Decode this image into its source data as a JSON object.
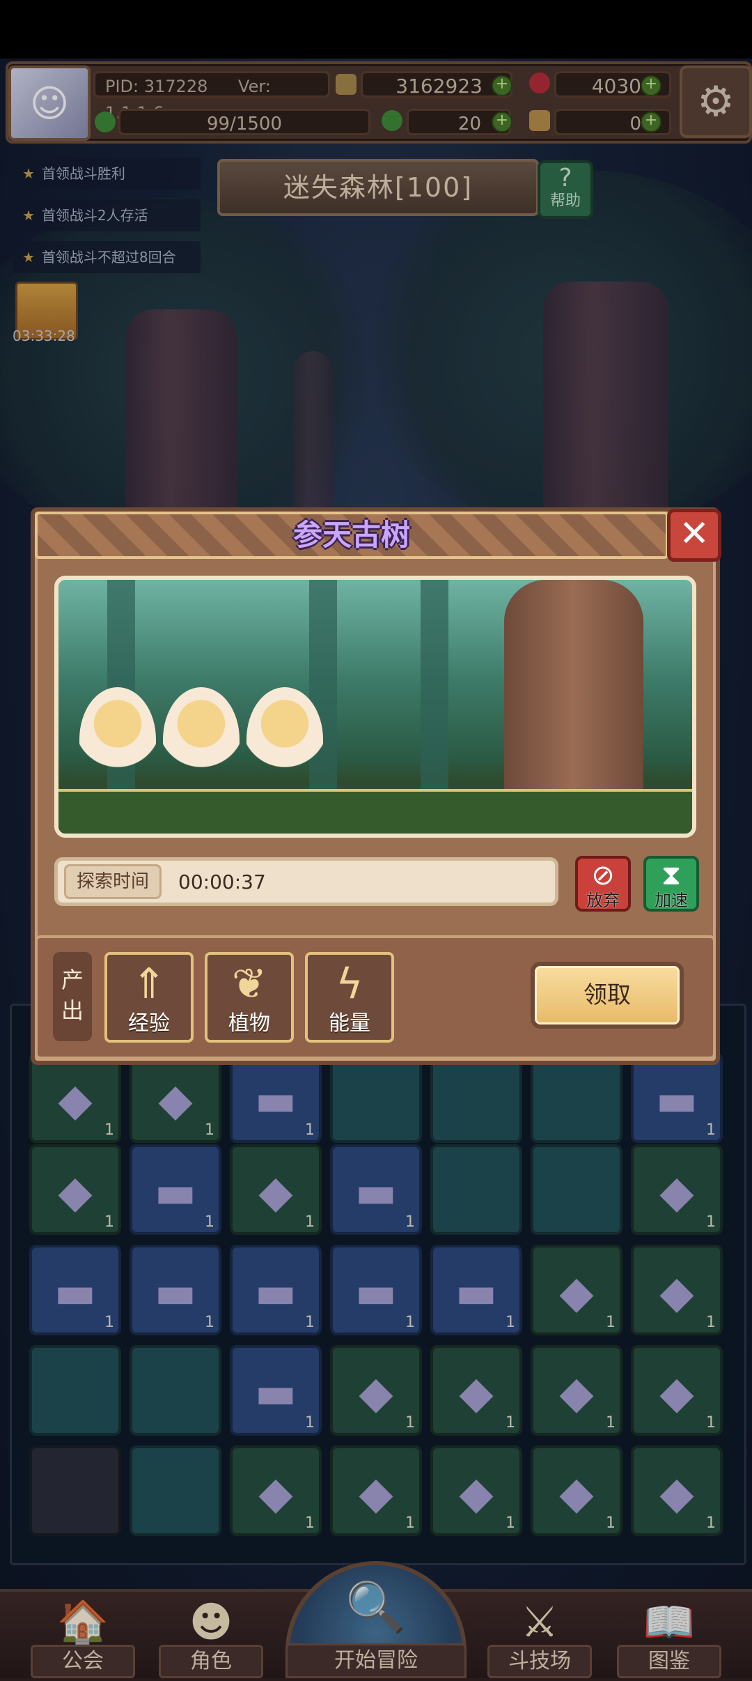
{
  "topbar": {
    "pid": "PID: 317228",
    "version": "Ver: 1.1.1.6",
    "coins": "3162923",
    "gems": "4030",
    "exp_progress": "99/1500",
    "clover": "20",
    "key": "0"
  },
  "quests": [
    "首领战斗胜利",
    "首领战斗2人存活",
    "首领战斗不超过8回合"
  ],
  "level": {
    "title": "迷失森林[100]",
    "help": "帮助"
  },
  "gift": {
    "timer": "03:33:28"
  },
  "dialog": {
    "title": "参天古树",
    "timer_label": "探索时间",
    "timer_value": "00:00:37",
    "give_up": "放弃",
    "speed_up": "加速",
    "output_label": "产出",
    "outputs": [
      "经验",
      "植物",
      "能量"
    ],
    "claim": "领取"
  },
  "grid": {
    "counts": "1"
  },
  "nav": {
    "guild": "公会",
    "character": "角色",
    "start": "开始冒险",
    "arena": "斗技场",
    "codex": "图鉴"
  },
  "colors": {
    "title_purple": "#caa6ff",
    "panel_brown": "#9b6f52",
    "gold_border": "#e2c27d"
  }
}
